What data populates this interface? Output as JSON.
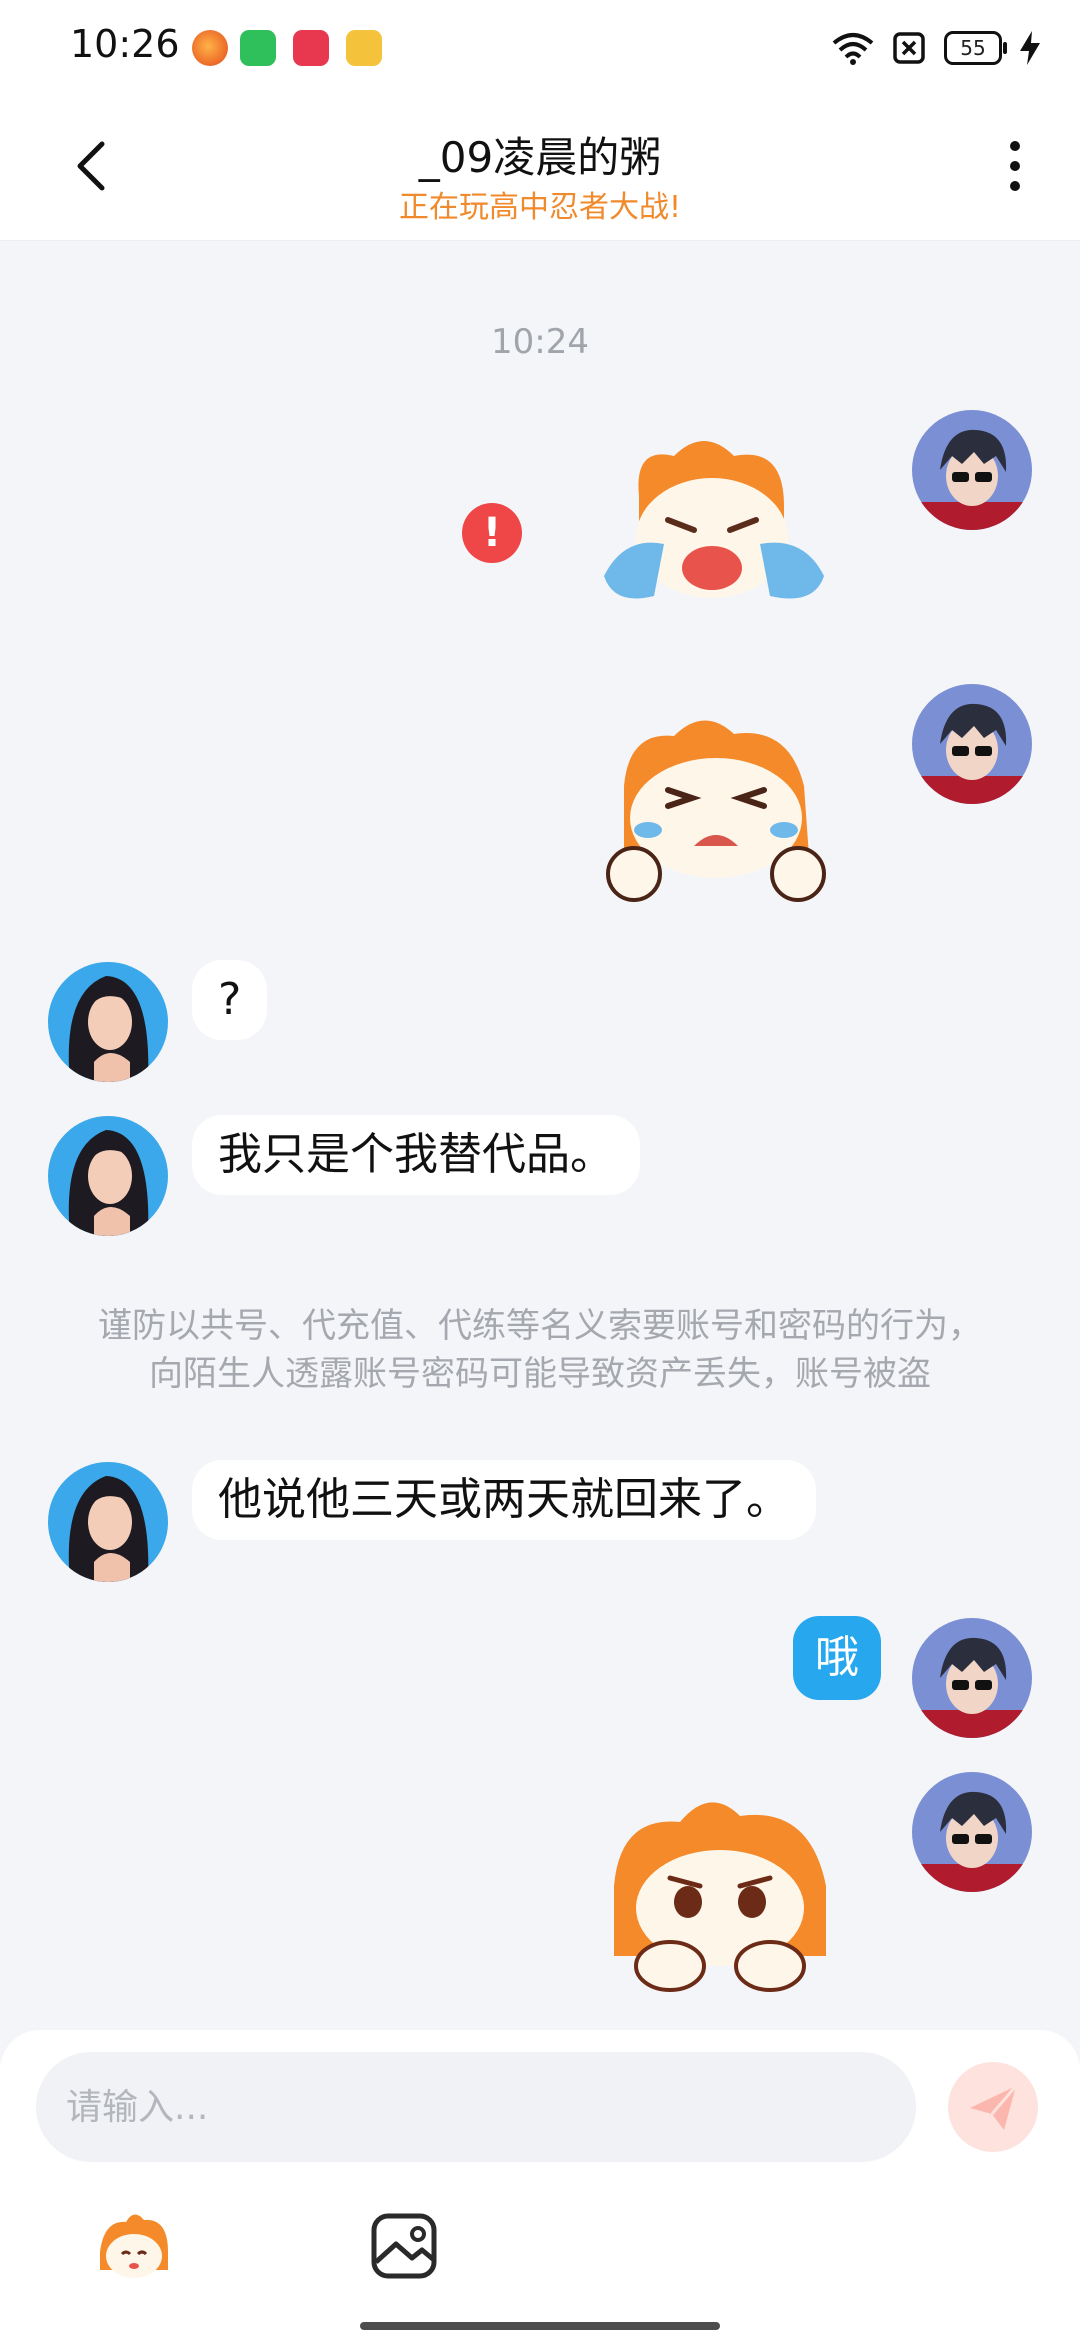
{
  "status_bar": {
    "time": "10:26",
    "battery": "55",
    "icons": [
      "app-orange-icon",
      "app-green-icon",
      "app-red-icon",
      "app-yellow-icon",
      "wifi-icon",
      "sim-off-icon",
      "battery-icon",
      "charging-icon"
    ]
  },
  "header": {
    "title": "_09凌晨的粥",
    "subtitle": "正在玩高中忍者大战!",
    "icons": [
      "back-icon",
      "more-icon"
    ]
  },
  "conversation": {
    "timestamp": "10:24",
    "messages": [
      {
        "from": "me",
        "type": "sticker",
        "sticker": "crying-fox-sticker",
        "failed": true
      },
      {
        "from": "me",
        "type": "sticker",
        "sticker": "sobbing-fox-sticker"
      },
      {
        "from": "other",
        "type": "text",
        "text": "?"
      },
      {
        "from": "other",
        "type": "text",
        "text": "我只是个我替代品。"
      },
      {
        "from": "system",
        "type": "notice",
        "text": "谨防以共号、代充值、代练等名义索要账号和密码的行为，向陌生人透露账号密码可能导致资产丢失，账号被盗"
      },
      {
        "from": "other",
        "type": "text",
        "text": "他说他三天或两天就回来了。"
      },
      {
        "from": "me",
        "type": "text",
        "text": "哦"
      },
      {
        "from": "me",
        "type": "sticker",
        "sticker": "sad-fox-sticker"
      }
    ],
    "error_mark": "!"
  },
  "composer": {
    "placeholder": "请输入...",
    "icons": [
      "send-icon",
      "sticker-icon",
      "image-icon"
    ]
  },
  "colors": {
    "accent_blue": "#26a7ee",
    "subtitle_orange": "#f08a2c",
    "error_red": "#ef4747",
    "background": "#f4f5f8"
  }
}
